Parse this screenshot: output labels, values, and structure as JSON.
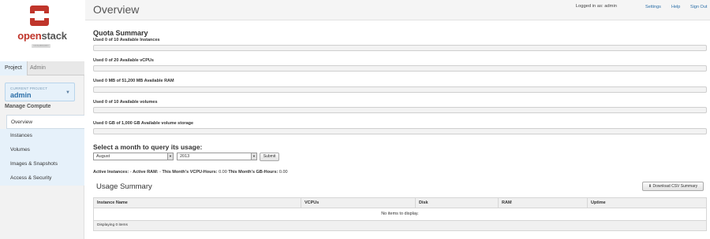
{
  "brand": {
    "name_prefix": "open",
    "name_suffix": "stack",
    "sub": "DASHBOARD"
  },
  "sidebar": {
    "tabs": [
      {
        "label": "Project",
        "active": true
      },
      {
        "label": "Admin",
        "active": false
      }
    ],
    "current_project": {
      "caption": "CURRENT PROJECT",
      "name": "admin"
    },
    "section_title": "Manage Compute",
    "items": [
      {
        "label": "Overview",
        "active": true
      },
      {
        "label": "Instances"
      },
      {
        "label": "Volumes"
      },
      {
        "label": "Images & Snapshots"
      },
      {
        "label": "Access & Security"
      }
    ]
  },
  "header": {
    "title": "Overview",
    "user": "Logged in as: admin",
    "links": {
      "settings": "Settings",
      "help": "Help",
      "sign_out": "Sign Out"
    }
  },
  "quota": {
    "title": "Quota Summary",
    "items": [
      {
        "label": "Used 0 of 10 Available Instances",
        "fraction": 0
      },
      {
        "label": "Used 0 of 20 Available vCPUs",
        "fraction": 0
      },
      {
        "label": "Used 0 MB of 51,200 MB Available RAM",
        "fraction": 0
      },
      {
        "label": "Used 0 of 10 Available volumes",
        "fraction": 0
      },
      {
        "label": "Used 0 GB of 1,000 GB Available volume storage",
        "fraction": 0
      }
    ]
  },
  "query": {
    "title": "Select a month to query its usage:",
    "month": "August",
    "year": "2013",
    "submit": "Submit"
  },
  "stats": {
    "active_instances_label": "Active Instances:",
    "active_instances": "-",
    "active_ram_label": "Active RAM:",
    "active_ram": "-",
    "vcpu_hours_label": "This Month's VCPU-Hours:",
    "vcpu_hours": "0.00",
    "gb_hours_label": "This Month's GB-Hours:",
    "gb_hours": "0.00"
  },
  "usage": {
    "title": "Usage Summary",
    "csv_button": "Download CSV Summary",
    "columns": [
      "Instance Name",
      "VCPUs",
      "Disk",
      "RAM",
      "Uptime"
    ],
    "empty": "No items to display.",
    "footer": "Displaying 0 items"
  },
  "colors": {
    "accent": "#2c6fa8",
    "logo_red": "#c0352b",
    "sidebar_active_bg": "#e6f1fa"
  }
}
